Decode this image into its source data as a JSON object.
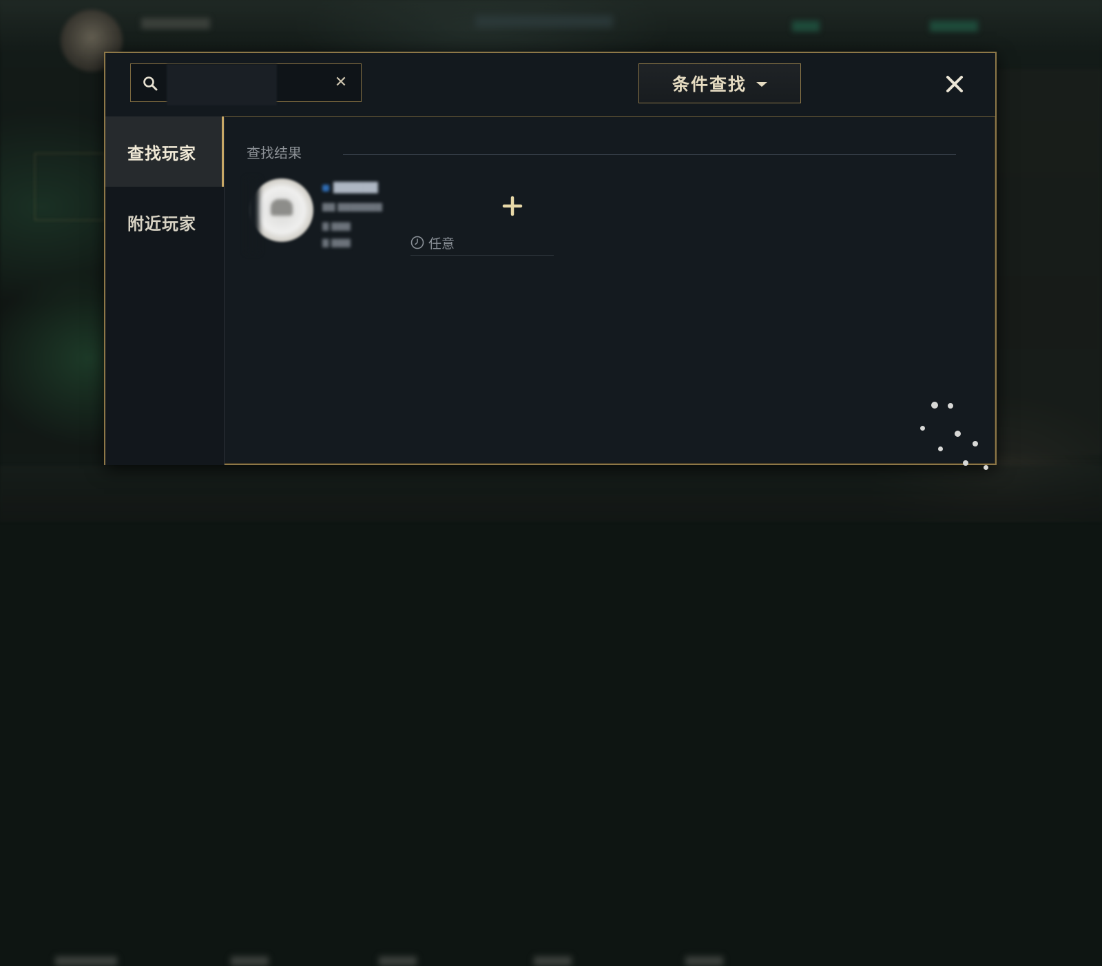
{
  "colors": {
    "gold_border": "#8e7848",
    "gold_text": "#e6dcc2",
    "panel_bg": "#141a1f",
    "active_tab_bg": "#262a2d",
    "muted_text": "#8c9196"
  },
  "search": {
    "placeholder": "",
    "clear_icon": "close-icon"
  },
  "header": {
    "filter_button_label": "条件查找",
    "filter_dropdown_icon": "caret-down-icon",
    "close_icon": "close-icon"
  },
  "sidebar": {
    "items": [
      {
        "label": "查找玩家",
        "active": true
      },
      {
        "label": "附近玩家",
        "active": false
      }
    ]
  },
  "results": {
    "title": "查找结果",
    "players": [
      {
        "add_icon": "plus-icon",
        "online_time": "任意",
        "time_icon": "clock-icon"
      }
    ]
  }
}
